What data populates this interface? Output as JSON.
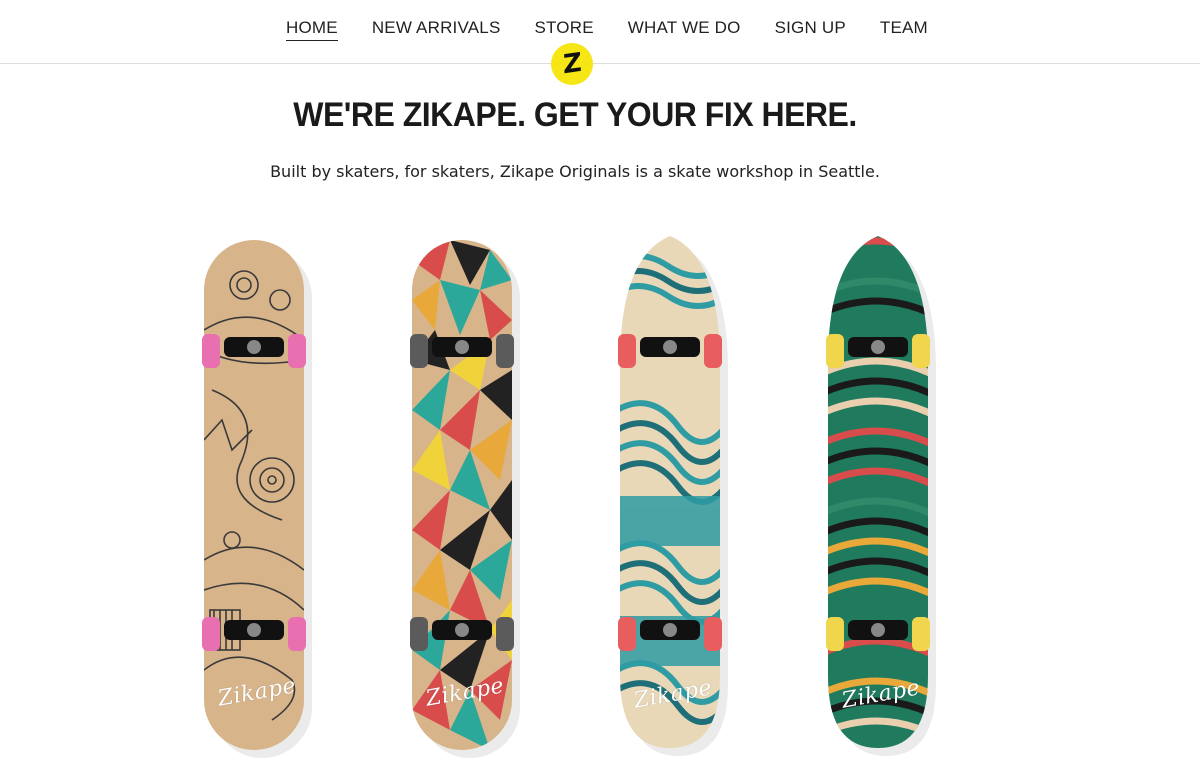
{
  "nav": {
    "items": [
      {
        "label": "HOME",
        "active": true
      },
      {
        "label": "NEW ARRIVALS"
      },
      {
        "label": "STORE"
      },
      {
        "label": "WHAT WE DO"
      },
      {
        "label": "SIGN UP"
      },
      {
        "label": "TEAM"
      }
    ]
  },
  "logo": {
    "letter": "Z",
    "color": "#f7e615"
  },
  "hero": {
    "headline": "WE'RE ZIKAPE. GET YOUR FIX HERE.",
    "subline": "Built by skaters, for skaters, Zikape Originals is a skate workshop in Seattle."
  },
  "boards": [
    {
      "brand": "Zikape",
      "pattern": "doodle",
      "wheel_color": "#e86fb0"
    },
    {
      "brand": "Zikape",
      "pattern": "geometric",
      "wheel_color": "#5b5b5b"
    },
    {
      "brand": "Zikape",
      "pattern": "waves",
      "wheel_color": "#e85d5d"
    },
    {
      "brand": "Zikape",
      "pattern": "hills",
      "wheel_color": "#f1d64d"
    }
  ]
}
